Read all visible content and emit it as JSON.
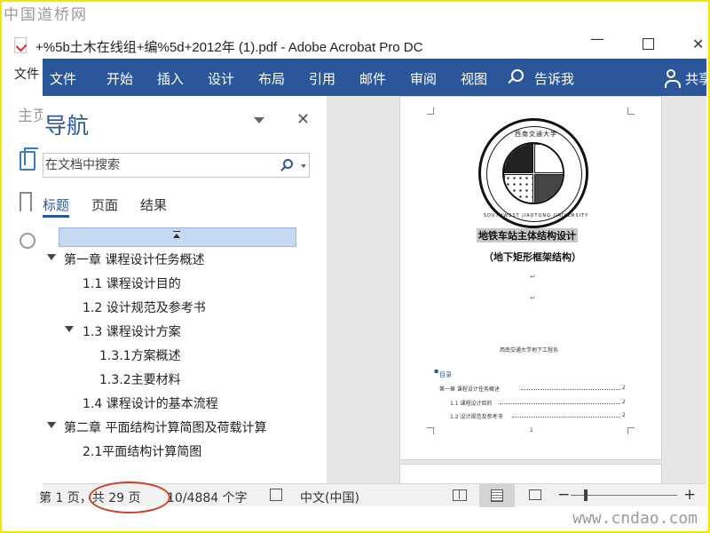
{
  "watermark": {
    "top": "中国道桥网",
    "bottom": "www.cndao.com"
  },
  "acrobat": {
    "title": "+%5b土木在线组+编%5d+2012年 (1).pdf - Adobe Acrobat Pro DC",
    "menu_file": "文件",
    "home_label": "主页",
    "window_controls": {
      "minimize": "—",
      "close": "✕"
    }
  },
  "ribbon": {
    "tabs": [
      "文件",
      "开始",
      "插入",
      "设计",
      "布局",
      "引用",
      "邮件",
      "审阅",
      "视图"
    ],
    "tell_me": "告诉我",
    "share": "共享",
    "accent_color": "#2b579a"
  },
  "nav": {
    "title": "导航",
    "close_label": "✕",
    "search_placeholder": "在文档中搜索",
    "tabs": [
      "标题",
      "页面",
      "结果"
    ],
    "headings": [
      {
        "text": "第一章 课程设计任务概述",
        "level": 1,
        "expanded": true
      },
      {
        "text": "1.1 课程设计目的",
        "level": 2
      },
      {
        "text": "1.2 设计规范及参考书",
        "level": 2
      },
      {
        "text": "1.3 课程设计方案",
        "level": 2,
        "expanded": true
      },
      {
        "text": "1.3.1方案概述",
        "level": 3
      },
      {
        "text": "1.3.2主要材料",
        "level": 3
      },
      {
        "text": "1.4 课程设计的基本流程",
        "level": 2
      },
      {
        "text": "第二章 平面结构计算简图及荷载计算",
        "level": 1,
        "expanded": true
      },
      {
        "text": "2.1平面结构计算简图",
        "level": 2
      }
    ]
  },
  "document": {
    "logo_text_top": "西南交通大学",
    "logo_text_bottom": "SOUTHWEST JIAOTONG UNIVERSITY",
    "title": "地铁车站主体结构设计",
    "subtitle": "（地下矩形框架结构）",
    "org": "西南交通大学地下工程系",
    "toc_title": "目录",
    "toc": [
      {
        "text": "第一章  课程设计任务概述",
        "page": "2"
      },
      {
        "text": "1.1  课程设计目的",
        "page": "2"
      },
      {
        "text": "1.2  设计规范及参考书",
        "page": "2"
      }
    ],
    "page_number": "1"
  },
  "status": {
    "page": "第 1 页，共 29 页",
    "words": "10/4884 个字",
    "language": "中文(中国)",
    "zoom_minus": "−",
    "zoom_plus": "+"
  }
}
